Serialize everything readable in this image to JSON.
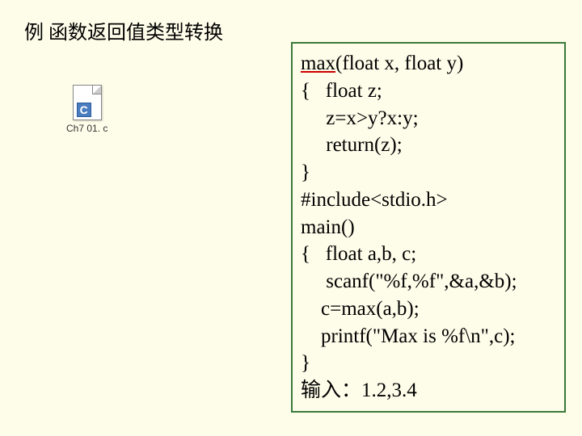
{
  "title": "例 函数返回值类型转换",
  "file": {
    "letter": "C",
    "label": "Ch7 01. c"
  },
  "code": {
    "l1_func": "max",
    "l1_rest": "(float x, float y)",
    "l2": "{   float z;",
    "l3": "     z=x>y?x:y;",
    "l4": "     return(z);",
    "l5": "}",
    "l6": "#include<stdio.h>",
    "l7": "main()",
    "l8": "{   float a,b, c;",
    "l9": "     scanf(\"%f,%f\",&a,&b);",
    "l10": "    c=max(a,b);",
    "l11": "    printf(\"Max is %f\\n\",c);",
    "l12": "}",
    "input_label": "输入：",
    "input_value": "1.2,3.4"
  }
}
